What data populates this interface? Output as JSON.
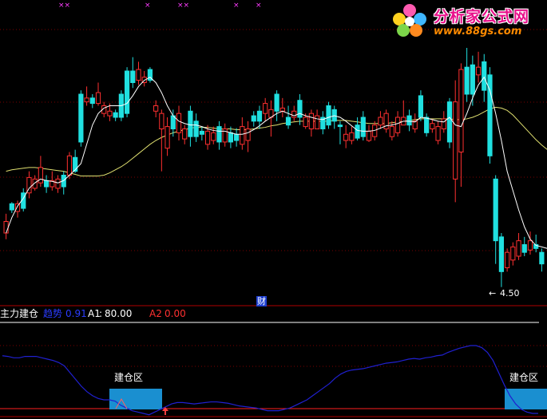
{
  "watermark": {
    "title": "分析家公式网",
    "url": "www.88gs.com",
    "logo_icon": "flower-logo-icon"
  },
  "top_marks": [
    "××",
    "×",
    "××",
    "×",
    "×"
  ],
  "price_panel": {
    "finance_marker": "财",
    "low_annotation": "4.50",
    "colors": {
      "up": "#ff3030",
      "down": "#20e0e0",
      "ma_short": "#ffffff",
      "ma_long": "#e0e070"
    }
  },
  "indicator_panel": {
    "name": "主力建仓",
    "field1_label": "趋势",
    "field1_value": "0.91",
    "field2_label": "A1",
    "field2_value": "80.00",
    "field3_label": "A2",
    "field3_value": "0.00",
    "zone_label_1": "建仓区",
    "zone_label_2": "建仓区",
    "colors": {
      "curve": "#2020d0",
      "zone": "#1a8fd0"
    }
  },
  "chart_data": {
    "type": "candlestick",
    "candles": [
      [
        1,
        75,
        60,
        85,
        52
      ],
      [
        0,
        90,
        98,
        100,
        86
      ],
      [
        1,
        98,
        88,
        102,
        80
      ],
      [
        0,
        92,
        112,
        118,
        88
      ],
      [
        1,
        112,
        132,
        140,
        105
      ],
      [
        1,
        130,
        118,
        135,
        115
      ],
      [
        1,
        125,
        145,
        160,
        120
      ],
      [
        0,
        120,
        128,
        135,
        112
      ],
      [
        1,
        120,
        128,
        140,
        115
      ],
      [
        1,
        118,
        130,
        135,
        112
      ],
      [
        0,
        120,
        135,
        140,
        110
      ],
      [
        1,
        135,
        160,
        165,
        130
      ],
      [
        0,
        140,
        158,
        168,
        138
      ],
      [
        0,
        178,
        240,
        245,
        172
      ],
      [
        1,
        230,
        235,
        250,
        225
      ],
      [
        0,
        235,
        228,
        240,
        222
      ],
      [
        1,
        228,
        242,
        255,
        225
      ],
      [
        1,
        215,
        225,
        230,
        210
      ],
      [
        1,
        212,
        218,
        228,
        205
      ],
      [
        0,
        210,
        216,
        220,
        205
      ],
      [
        0,
        210,
        240,
        245,
        205
      ],
      [
        0,
        215,
        270,
        275,
        210
      ],
      [
        0,
        255,
        270,
        288,
        248
      ],
      [
        1,
        258,
        272,
        282,
        252
      ],
      [
        1,
        255,
        262,
        270,
        250
      ],
      [
        0,
        258,
        272,
        275,
        255
      ],
      [
        1,
        218,
        225,
        232,
        210
      ],
      [
        1,
        195,
        215,
        220,
        140
      ],
      [
        1,
        170,
        198,
        210,
        160
      ],
      [
        0,
        195,
        212,
        220,
        185
      ],
      [
        1,
        190,
        215,
        225,
        180
      ],
      [
        1,
        182,
        195,
        200,
        175
      ],
      [
        0,
        185,
        218,
        225,
        172
      ],
      [
        0,
        185,
        205,
        215,
        178
      ],
      [
        0,
        188,
        192,
        198,
        180
      ],
      [
        1,
        175,
        192,
        200,
        168
      ],
      [
        1,
        180,
        190,
        198,
        175
      ],
      [
        0,
        178,
        198,
        205,
        168
      ],
      [
        1,
        178,
        195,
        202,
        172
      ],
      [
        0,
        178,
        190,
        198,
        170
      ],
      [
        0,
        180,
        188,
        196,
        172
      ],
      [
        1,
        175,
        198,
        210,
        168
      ],
      [
        1,
        180,
        195,
        205,
        165
      ],
      [
        0,
        205,
        212,
        218,
        198
      ],
      [
        0,
        205,
        218,
        225,
        195
      ],
      [
        1,
        215,
        228,
        235,
        205
      ],
      [
        1,
        210,
        220,
        232,
        185
      ],
      [
        0,
        218,
        240,
        245,
        205
      ],
      [
        1,
        218,
        222,
        235,
        210
      ],
      [
        0,
        200,
        210,
        225,
        195
      ],
      [
        1,
        210,
        218,
        225,
        205
      ],
      [
        0,
        210,
        232,
        240,
        200
      ],
      [
        1,
        198,
        210,
        215,
        195
      ],
      [
        1,
        195,
        215,
        220,
        185
      ],
      [
        1,
        195,
        212,
        220,
        195
      ],
      [
        0,
        195,
        210,
        218,
        188
      ],
      [
        0,
        200,
        225,
        230,
        195
      ],
      [
        0,
        205,
        220,
        225,
        195
      ],
      [
        0,
        198,
        200,
        205,
        175
      ],
      [
        1,
        180,
        188,
        200,
        170
      ],
      [
        1,
        180,
        190,
        198,
        175
      ],
      [
        0,
        183,
        200,
        210,
        180
      ],
      [
        0,
        185,
        210,
        218,
        180
      ],
      [
        1,
        180,
        192,
        200,
        178
      ],
      [
        1,
        185,
        200,
        205,
        180
      ],
      [
        1,
        200,
        210,
        218,
        195
      ],
      [
        1,
        195,
        215,
        220,
        190
      ],
      [
        1,
        185,
        198,
        205,
        180
      ],
      [
        1,
        190,
        210,
        218,
        185
      ],
      [
        1,
        200,
        210,
        232,
        200
      ],
      [
        0,
        200,
        212,
        220,
        192
      ],
      [
        1,
        195,
        205,
        215,
        190
      ],
      [
        0,
        210,
        238,
        245,
        205
      ],
      [
        0,
        190,
        210,
        215,
        185
      ],
      [
        1,
        195,
        202,
        208,
        190
      ],
      [
        1,
        180,
        198,
        205,
        175
      ],
      [
        1,
        195,
        208,
        218,
        190
      ],
      [
        0,
        178,
        230,
        235,
        170
      ],
      [
        1,
        130,
        230,
        258,
        100
      ],
      [
        1,
        165,
        272,
        280,
        120
      ],
      [
        0,
        240,
        275,
        300,
        230
      ],
      [
        0,
        240,
        278,
        290,
        225
      ],
      [
        1,
        265,
        275,
        295,
        255
      ],
      [
        0,
        245,
        282,
        292,
        230
      ],
      [
        0,
        160,
        265,
        275,
        150
      ],
      [
        0,
        50,
        130,
        135,
        20
      ],
      [
        0,
        10,
        55,
        60,
        -10
      ],
      [
        1,
        15,
        35,
        40,
        10
      ],
      [
        1,
        25,
        42,
        48,
        18
      ],
      [
        1,
        30,
        50,
        60,
        25
      ],
      [
        0,
        35,
        45,
        55,
        30
      ],
      [
        1,
        38,
        50,
        62,
        32
      ],
      [
        0,
        40,
        45,
        58,
        35
      ],
      [
        0,
        20,
        35,
        40,
        10
      ]
    ],
    "ma_short": [
      60,
      80,
      95,
      105,
      118,
      125,
      130,
      128,
      127,
      125,
      128,
      135,
      142,
      150,
      175,
      200,
      215,
      222,
      225,
      225,
      225,
      228,
      238,
      250,
      258,
      262,
      255,
      242,
      225,
      212,
      205,
      202,
      200,
      200,
      198,
      195,
      193,
      192,
      192,
      190,
      188,
      188,
      190,
      194,
      199,
      205,
      210,
      215,
      218,
      215,
      212,
      215,
      212,
      210,
      208,
      207,
      210,
      212,
      210,
      205,
      199,
      193,
      192,
      192,
      193,
      196,
      199,
      200,
      202,
      205,
      205,
      204,
      210,
      209,
      207,
      205,
      204,
      210,
      200,
      198,
      215,
      235,
      252,
      262,
      245,
      215,
      180,
      140,
      115,
      90,
      68,
      52,
      44,
      42,
      40,
      35
    ],
    "ma_long": [
      140,
      142,
      143,
      144,
      145,
      145,
      144,
      143,
      142,
      141,
      140,
      138,
      136,
      134,
      134,
      134,
      134,
      135,
      138,
      142,
      146,
      151,
      157,
      163,
      169,
      175,
      180,
      184,
      187,
      190,
      192,
      194,
      196,
      197,
      197,
      197,
      196,
      195,
      195,
      195,
      194,
      194,
      194,
      195,
      196,
      197,
      199,
      200,
      202,
      203,
      204,
      205,
      205,
      205,
      205,
      205,
      205,
      206,
      206,
      206,
      205,
      204,
      203,
      202,
      202,
      202,
      202,
      203,
      204,
      205,
      206,
      207,
      208,
      208,
      208,
      208,
      208,
      208,
      207,
      207,
      208,
      210,
      213,
      217,
      221,
      223,
      222,
      219,
      213,
      205,
      197,
      189,
      181,
      174,
      168,
      162
    ],
    "indicator_curve": [
      85,
      84,
      82,
      82,
      84,
      84,
      84,
      82,
      80,
      78,
      75,
      70,
      60,
      50,
      40,
      32,
      26,
      22,
      20,
      20,
      18,
      12,
      8,
      4,
      2,
      0,
      -2,
      2,
      6,
      10,
      14,
      16,
      16,
      15,
      14,
      15,
      16,
      17,
      17,
      16,
      15,
      13,
      11,
      10,
      9,
      8,
      6,
      4,
      4,
      4,
      6,
      8,
      12,
      16,
      20,
      26,
      32,
      38,
      44,
      52,
      58,
      62,
      64,
      65,
      66,
      68,
      70,
      72,
      74,
      75,
      76,
      78,
      80,
      81,
      80,
      82,
      83,
      85,
      86,
      90,
      93,
      96,
      98,
      100,
      100,
      97,
      90,
      78,
      60,
      42,
      26,
      14,
      6,
      2,
      0,
      0
    ],
    "zones": [
      [
        137,
        203
      ],
      [
        632,
        685
      ]
    ]
  }
}
